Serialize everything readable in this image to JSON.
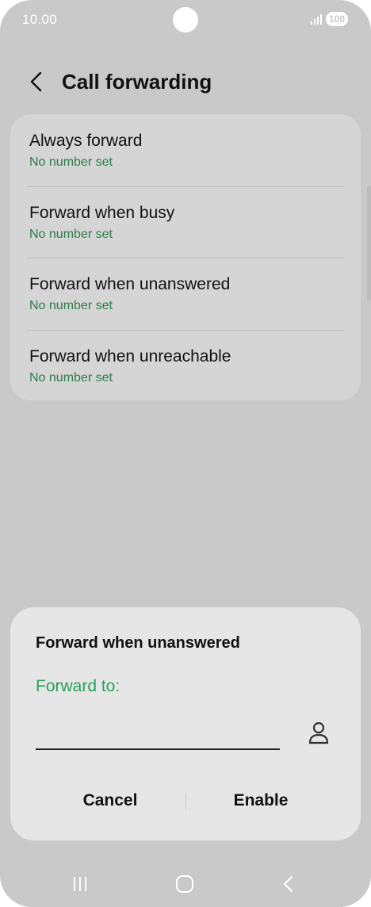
{
  "status_bar": {
    "time": "10.00",
    "battery": "100"
  },
  "header": {
    "title": "Call forwarding"
  },
  "forwarding_options": [
    {
      "title": "Always forward",
      "subtitle": "No number set"
    },
    {
      "title": "Forward when busy",
      "subtitle": "No number set"
    },
    {
      "title": "Forward when unanswered",
      "subtitle": "No number set"
    },
    {
      "title": "Forward when unreachable",
      "subtitle": "No number set"
    }
  ],
  "dialog": {
    "title": "Forward when unanswered",
    "field_label": "Forward to:",
    "number_value": "",
    "cancel_label": "Cancel",
    "enable_label": "Enable"
  },
  "colors": {
    "accent_green": "#27a35a",
    "subtitle_green": "#2e7d4a",
    "background": "#c9c9c9"
  },
  "icons": {
    "back": "chevron-left-icon",
    "contact": "person-icon",
    "nav_recents": "recents-icon",
    "nav_home": "home-icon",
    "nav_back": "back-icon"
  }
}
